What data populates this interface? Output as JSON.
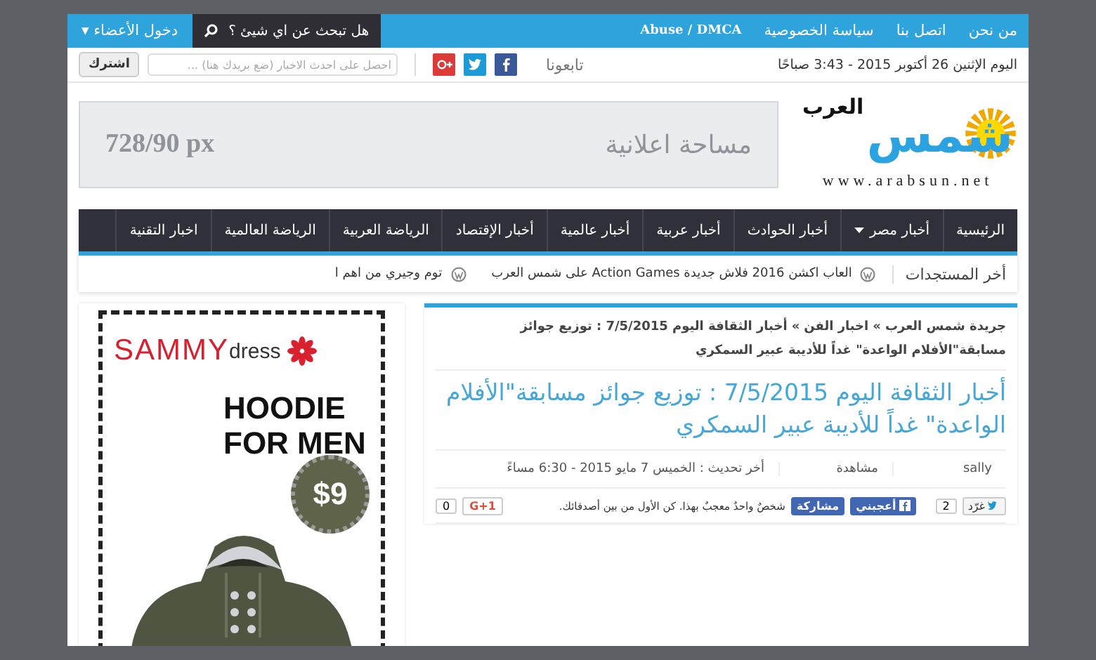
{
  "top_bar": {
    "links": [
      "من نحن",
      "اتصل بنا",
      "سياسة الخصوصية",
      "Abuse / DMCA"
    ],
    "search": {
      "placeholder": "هل تبحث عن اي شيئ ؟"
    },
    "members": {
      "label": "دخول الأعضاء",
      "caret": "▾"
    }
  },
  "info_bar": {
    "date": "اليوم الإثنين 26 أكتوبر 2015 - 3:43 صباحًا",
    "follow_label": "تابعونا",
    "newsletter": {
      "placeholder": "احصل على احدث الاخبار (ضع بريدك هنا) ...",
      "button": "اشترك"
    }
  },
  "header": {
    "logo": {
      "main": "شمس",
      "sub": "العرب",
      "url": "www.arabsun.net"
    },
    "ad": {
      "label": "مساحة اعلانية",
      "size": "728/90 px"
    }
  },
  "nav": [
    {
      "label": "الرئيسية",
      "has_menu": false
    },
    {
      "label": "أخبار مصر",
      "has_menu": true
    },
    {
      "label": "أخبار الحوادث",
      "has_menu": false
    },
    {
      "label": "أخبار عربية",
      "has_menu": false
    },
    {
      "label": "أخبار عالمية",
      "has_menu": false
    },
    {
      "label": "أخبار الإقتصاد",
      "has_menu": false
    },
    {
      "label": "الرياضة العربية",
      "has_menu": false
    },
    {
      "label": "الرياضة العالمية",
      "has_menu": false
    },
    {
      "label": "اخبار التقنية",
      "has_menu": false
    }
  ],
  "ticker": {
    "label": "أخر المستجدات",
    "items": [
      "العاب اكشن 2016 فلاش جديدة Action Games على شمس العرب",
      "توم وجيري من اهم ا"
    ]
  },
  "article": {
    "breadcrumb": [
      "جريدة شمس العرب",
      "اخبار الفن",
      "أخبار الثقافة اليوم 7/5/2015 : توزيع جوائز مسابقة\"الأفلام الواعدة\" غداً للأديبة عبير السمكري"
    ],
    "separator": "»",
    "title": "أخبار الثقافة اليوم 7/5/2015 : توزيع جوائز مسابقة\"الأفلام الواعدة\" غداً للأديبة عبير السمكري",
    "meta": {
      "author": "sally",
      "views": "مشاهدة",
      "updated": "أخر تحديث : الخميس 7 مايو 2015 - 6:30 مساءً"
    },
    "share": {
      "tweet": "غرّد",
      "tweet_count": "2",
      "like": "أعجبني",
      "share": "مشاركة",
      "like_text": "شخصٌ واحدٌ معجبٌ بهذا. كن الأول من بين أصدقائك.",
      "plus_count": "0",
      "plus": "G+1"
    }
  },
  "sidebar_ad": {
    "brand": "SAMMY",
    "brand_suffix": "dress",
    "headline": "HOODIE FOR MEN",
    "price": "$9"
  }
}
